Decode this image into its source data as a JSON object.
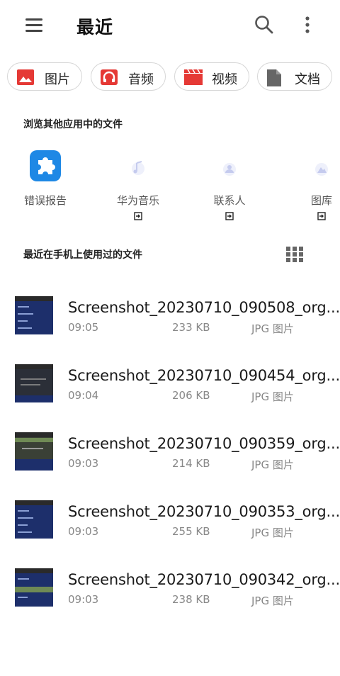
{
  "header": {
    "title": "最近"
  },
  "chips": [
    {
      "label": "图片",
      "icon": "image-icon",
      "color": "#e53935"
    },
    {
      "label": "音频",
      "icon": "headphones-icon",
      "color": "#e53935"
    },
    {
      "label": "视频",
      "icon": "clapperboard-icon",
      "color": "#e53935"
    },
    {
      "label": "文档",
      "icon": "document-icon",
      "color": "#666666"
    }
  ],
  "browse": {
    "title": "浏览其他应用中的文件",
    "apps": [
      {
        "label": "错误报告",
        "icon": "puzzle-icon",
        "color": "#1e88e5"
      },
      {
        "label": "华为音乐",
        "icon": "music-app-icon"
      },
      {
        "label": "联系人",
        "icon": "contacts-app-icon"
      },
      {
        "label": "图库",
        "icon": "gallery-app-icon"
      }
    ]
  },
  "recent": {
    "title": "最近在手机上使用过的文件",
    "files": [
      {
        "name": "Screenshot_20230710_090508_org....",
        "time": "09:05",
        "size": "233 KB",
        "type": "JPG 图片"
      },
      {
        "name": "Screenshot_20230710_090454_org....",
        "time": "09:04",
        "size": "206 KB",
        "type": "JPG 图片"
      },
      {
        "name": "Screenshot_20230710_090359_org....",
        "time": "09:03",
        "size": "214 KB",
        "type": "JPG 图片"
      },
      {
        "name": "Screenshot_20230710_090353_org....",
        "time": "09:03",
        "size": "255 KB",
        "type": "JPG 图片"
      },
      {
        "name": "Screenshot_20230710_090342_org....",
        "time": "09:03",
        "size": "238 KB",
        "type": "JPG 图片"
      }
    ]
  }
}
